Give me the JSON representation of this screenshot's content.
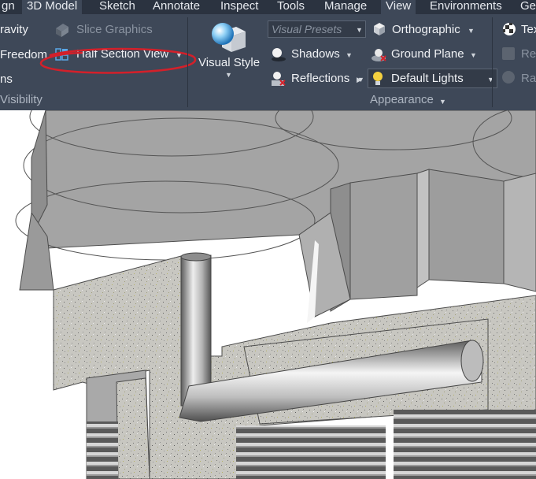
{
  "tabs": [
    "gn",
    "3D Model",
    "Sketch",
    "Annotate",
    "Inspect",
    "Tools",
    "Manage",
    "View",
    "Environments",
    "Ge"
  ],
  "ribbon": {
    "gravity_label": "ravity",
    "freedom_label": "Freedom",
    "ns_label": "ns",
    "slice_graphics_label": "Slice Graphics",
    "half_section_label": "Half Section View",
    "visibility_group": "Visibility",
    "visual_style_label": "Visual Style",
    "visual_presets_placeholder": "Visual Presets",
    "shadows_label": "Shadows",
    "reflections_label": "Reflections",
    "orthographic_label": "Orthographic",
    "ground_plane_label": "Ground Plane",
    "default_lights_label": "Default Lights",
    "appearance_group": "Appearance",
    "tex_label": "Tex",
    "re_label": "Re",
    "ra_label": "Ra"
  },
  "colors": {
    "ribbon_bg": "#3e4858",
    "tabbar_bg": "#2b3340",
    "active_tab": "#3e4858",
    "annotation_red": "#d3202a",
    "model_gray": "#a6a6a6"
  },
  "icons": [
    "slice-graphics-icon",
    "half-section-icon",
    "visual-style-sphere-icon",
    "shadows-icon",
    "reflections-icon",
    "orthographic-icon",
    "ground-plane-icon",
    "default-lights-bulb-icon",
    "texture-checker-icon"
  ]
}
